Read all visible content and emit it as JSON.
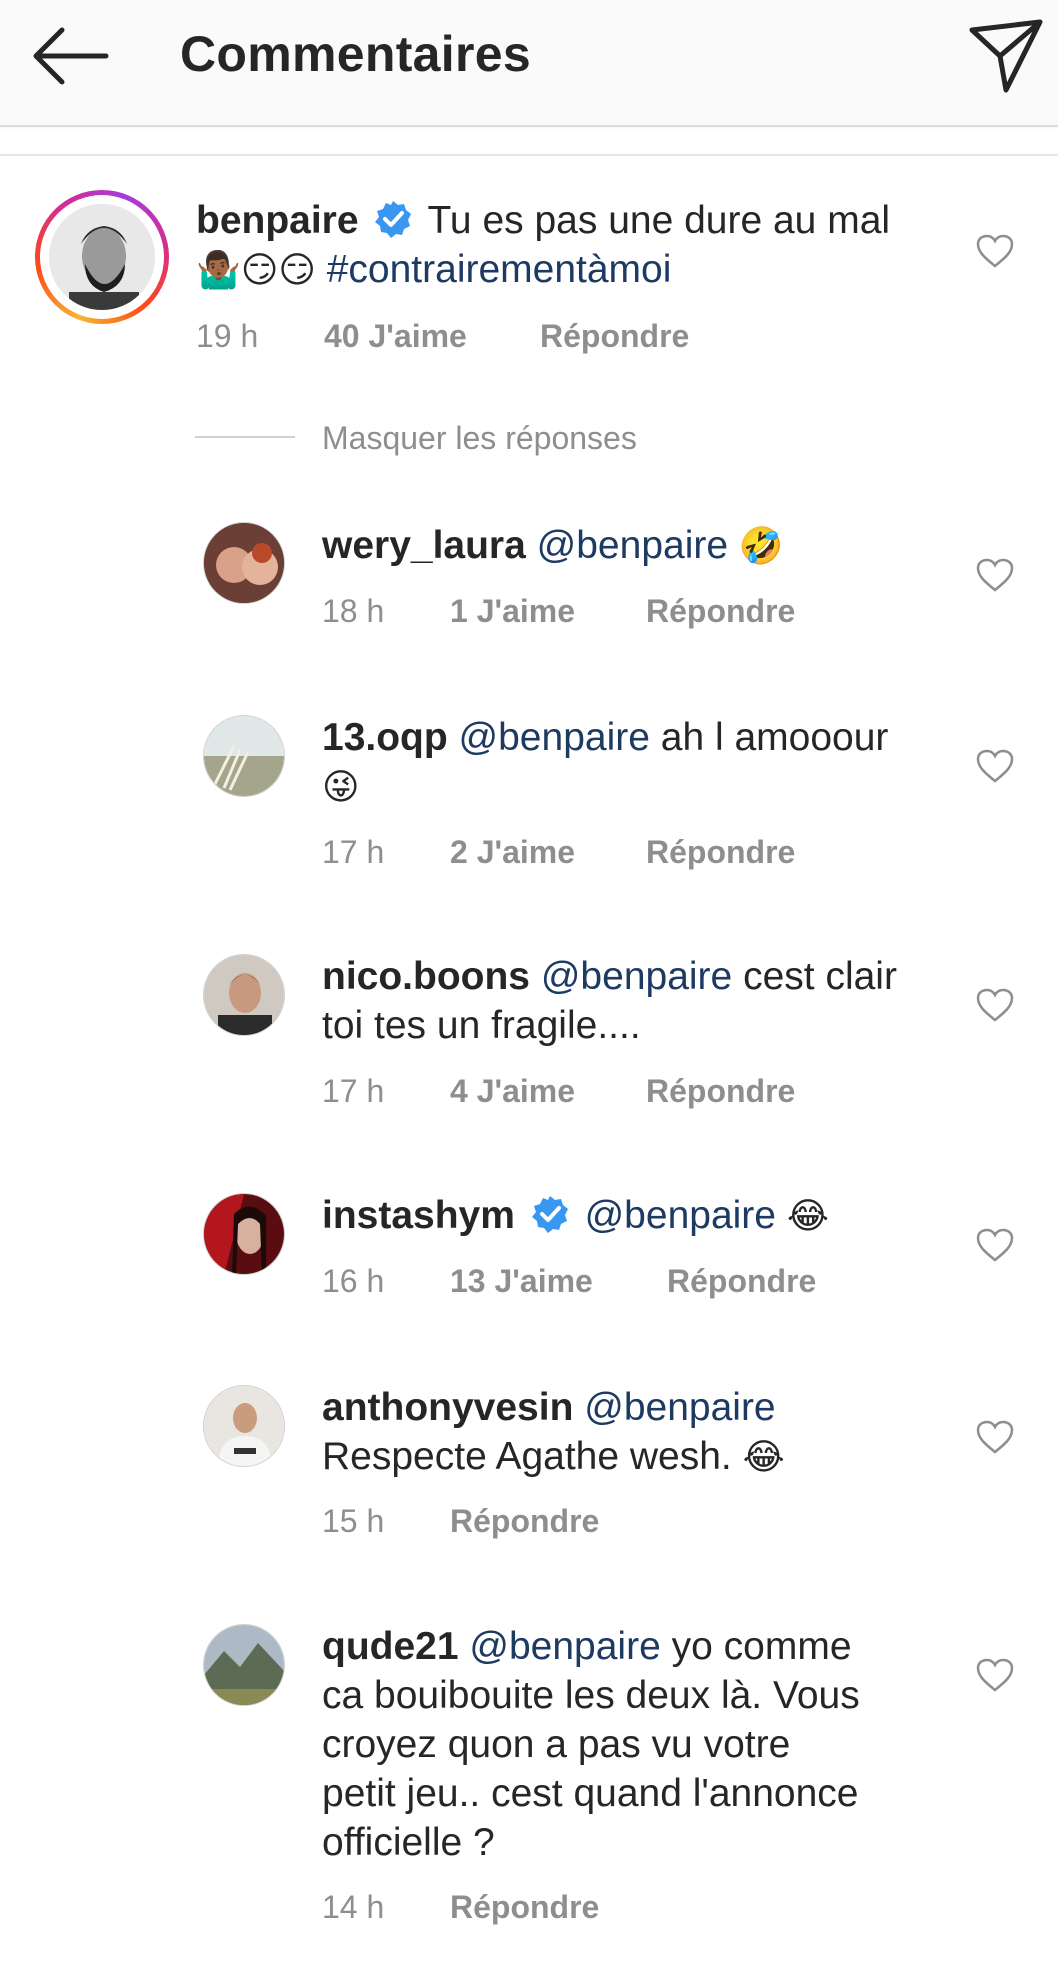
{
  "header": {
    "title": "Commentaires",
    "back_icon": "arrow-left-icon",
    "send_icon": "paper-plane-icon"
  },
  "main_comment": {
    "username": "benpaire",
    "verified": true,
    "text_line1": "Tu es pas une dure au mal",
    "emojis": "🤷🏾‍♂️😏😏",
    "hashtag": "#contrairementàmoi",
    "time": "19 h",
    "likes": "40 J'aime",
    "reply": "Répondre"
  },
  "hide_replies": "Masquer les réponses",
  "replies": [
    {
      "username": "wery_laura",
      "mention": "@benpaire",
      "text": "",
      "emoji": "🤣",
      "time": "18 h",
      "likes": "1 J'aime",
      "reply": "Répondre"
    },
    {
      "username": "13.oqp",
      "mention": "@benpaire",
      "text": "ah l amooour",
      "emoji": "😜",
      "time": "17 h",
      "likes": "2 J'aime",
      "reply": "Répondre"
    },
    {
      "username": "nico.boons",
      "mention": "@benpaire",
      "text": "cest clair",
      "text2": "toi tes un fragile....",
      "time": "17 h",
      "likes": "4 J'aime",
      "reply": "Répondre"
    },
    {
      "username": "instashym",
      "verified": true,
      "mention": "@benpaire",
      "emoji": "😂",
      "time": "16 h",
      "likes": "13 J'aime",
      "reply": "Répondre"
    },
    {
      "username": "anthonyvesin",
      "mention": "@benpaire",
      "text2": "Respecte Agathe wesh.",
      "emoji": "😂",
      "time": "15 h",
      "reply": "Répondre"
    },
    {
      "username": "qude21",
      "mention": "@benpaire",
      "text": "yo comme",
      "text2": "ca bouibouite les deux là. Vous",
      "text3": "croyez quon a pas vu votre",
      "text4": "petit jeu.. cest quand l'annonce",
      "text5": "officielle ?",
      "time": "14 h",
      "reply": "Répondre"
    }
  ],
  "colors": {
    "mention": "#1d3a62",
    "meta": "#8e8e8e",
    "verified": "#3897f0",
    "topbar": "#fafafa"
  }
}
